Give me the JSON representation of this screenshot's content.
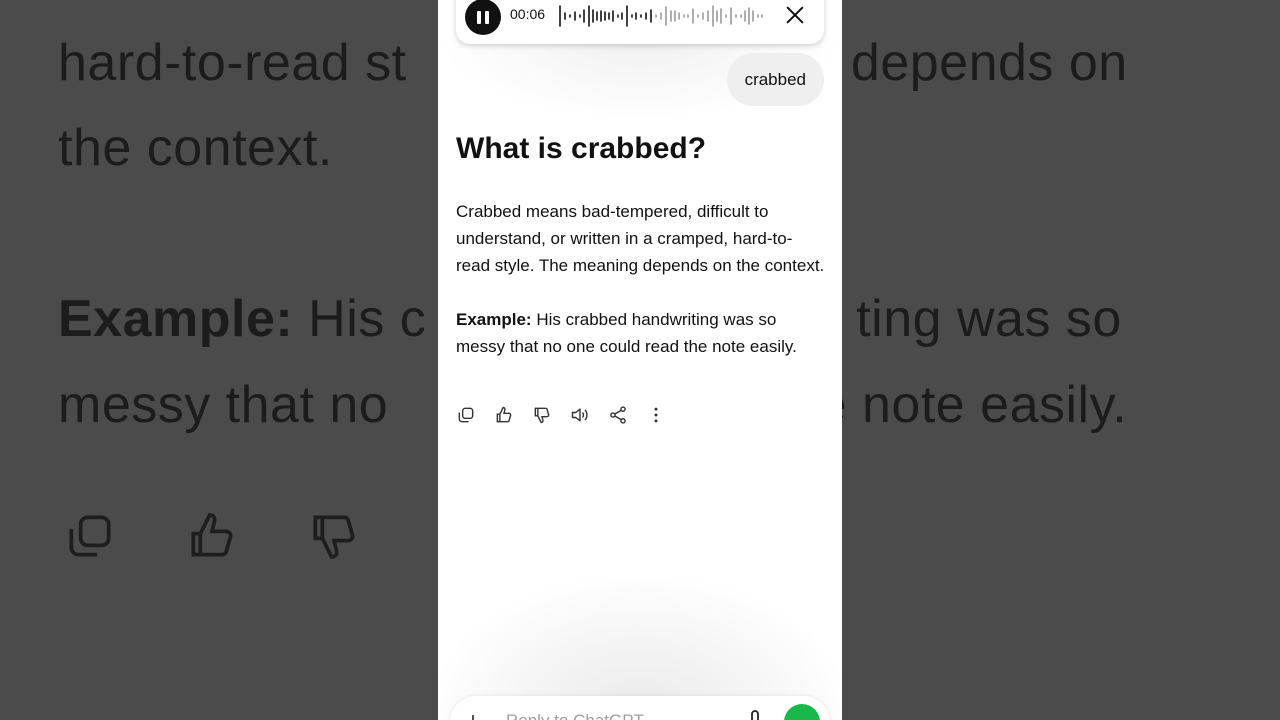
{
  "background": {
    "line1": "hard-to-read st",
    "line1b": "g depends on",
    "line2": "the context.",
    "example_label": "Example:",
    "line3a": " His c",
    "line3b": "ting was so",
    "line4a": "messy that no",
    "line4b": "he note easily."
  },
  "audio_player": {
    "time": "00:06",
    "state": "playing"
  },
  "conversation": {
    "user_message": "crabbed",
    "answer_title": "What is crabbed?",
    "answer_paragraph": "Crabbed means bad-tempered, difficult to understand, or written in a cramped, hard-to-read style. The meaning depends on the context.",
    "example_label": "Example:",
    "example_text": " His crabbed handwriting was so messy that no one could read the note easily."
  },
  "actions": [
    "copy-icon",
    "thumbs-up-icon",
    "thumbs-down-icon",
    "speaker-icon",
    "share-icon",
    "more-icon"
  ],
  "composer": {
    "placeholder": "Reply to ChatGPT"
  },
  "colors": {
    "accent_green": "#19b84a",
    "background_dim": "#4b4b4b"
  }
}
